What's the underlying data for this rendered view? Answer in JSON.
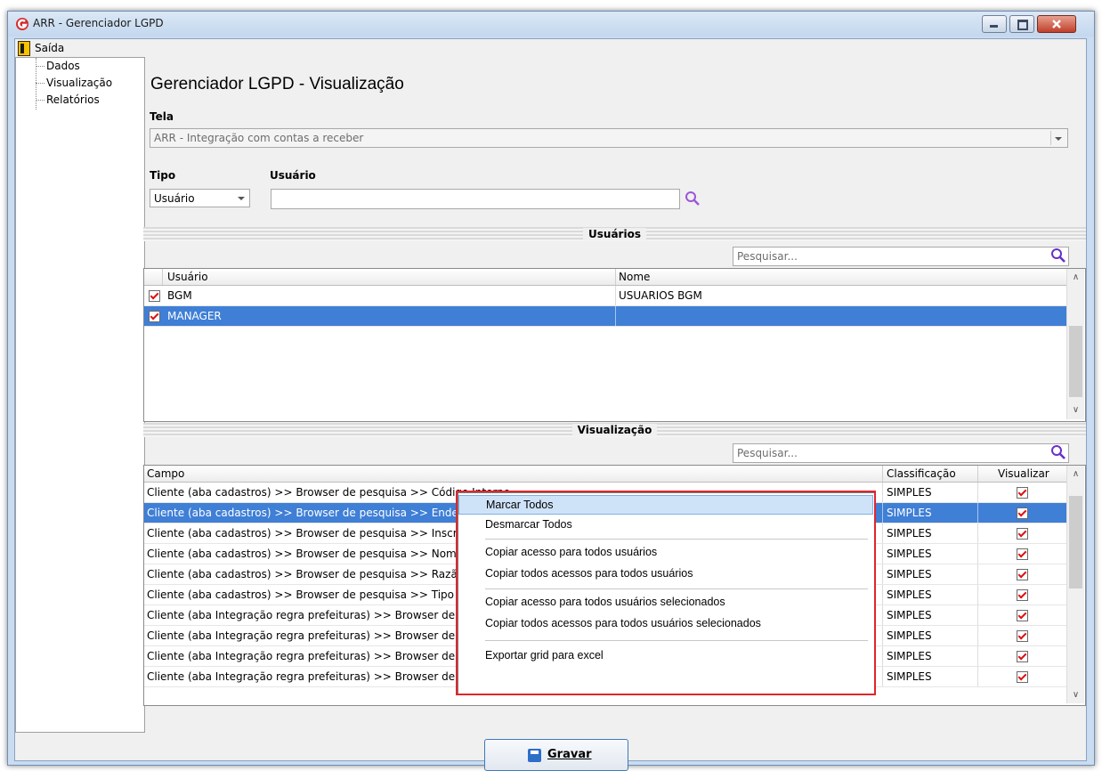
{
  "window": {
    "title": "ARR - Gerenciador LGPD"
  },
  "menu": {
    "saida": "Saída"
  },
  "tree": {
    "items": [
      "Dados",
      "Visualização",
      "Relatórios"
    ]
  },
  "page": {
    "heading": "Gerenciador LGPD - Visualização"
  },
  "tela": {
    "label": "Tela",
    "value": "ARR - Integração com contas a receber"
  },
  "tipo": {
    "label": "Tipo",
    "value": "Usuário"
  },
  "usuario_field": {
    "label": "Usuário",
    "value": ""
  },
  "usuarios_section": {
    "title": "Usuários",
    "search_placeholder": "Pesquisar...",
    "columns": [
      "Usuário",
      "Nome"
    ],
    "rows": [
      {
        "usuario": "BGM",
        "nome": "USUARIOS BGM",
        "checked": true
      },
      {
        "usuario": "MANAGER",
        "nome": "",
        "checked": true
      }
    ]
  },
  "visualizacao_section": {
    "title": "Visualização",
    "search_placeholder": "Pesquisar...",
    "columns": [
      "Campo",
      "Classificação",
      "Visualizar"
    ],
    "rows": [
      {
        "campo": "Cliente (aba cadastros) >> Browser de pesquisa >> Código Interno",
        "classificacao": "SIMPLES"
      },
      {
        "campo": "Cliente (aba cadastros) >> Browser de pesquisa >> Endereço",
        "classificacao": "SIMPLES"
      },
      {
        "campo": "Cliente (aba cadastros) >> Browser de pesquisa >> Inscrição",
        "classificacao": "SIMPLES"
      },
      {
        "campo": "Cliente (aba cadastros) >> Browser de pesquisa >> Nome Fa",
        "classificacao": "SIMPLES"
      },
      {
        "campo": "Cliente (aba cadastros) >> Browser de pesquisa >> Razão Sc",
        "classificacao": "SIMPLES"
      },
      {
        "campo": "Cliente (aba cadastros) >> Browser de pesquisa >> Tipo Insc",
        "classificacao": "SIMPLES"
      },
      {
        "campo": "Cliente (aba Integração regra prefeituras) >> Browser de peso",
        "classificacao": "SIMPLES"
      },
      {
        "campo": "Cliente (aba Integração regra prefeituras) >> Browser de peso",
        "classificacao": "SIMPLES"
      },
      {
        "campo": "Cliente (aba Integração regra prefeituras) >> Browser de peso",
        "classificacao": "SIMPLES"
      },
      {
        "campo": "Cliente (aba Integração regra prefeituras) >> Browser de peso",
        "classificacao": "SIMPLES"
      }
    ]
  },
  "context_menu": {
    "items": [
      "Marcar Todos",
      "Desmarcar Todos",
      "Copiar acesso para todos usuários",
      "Copiar todos acessos para todos usuários",
      "Copiar acesso para todos usuários selecionados",
      "Copiar todos acessos para todos usuários selecionados",
      "Exportar grid para excel"
    ]
  },
  "footer": {
    "gravar_label": "Gravar"
  },
  "colors": {
    "selection": "#3f7fd6",
    "highlight_border": "#e0262c",
    "accent": "#2d6ec9"
  }
}
